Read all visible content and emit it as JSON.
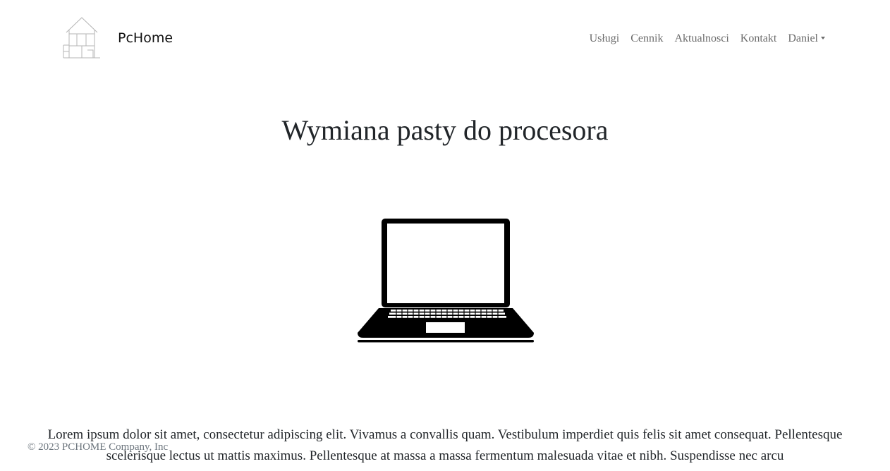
{
  "brand": {
    "name": "PcHome",
    "logo_icon": "house-outline-icon"
  },
  "nav": {
    "items": [
      {
        "label": "Usługi"
      },
      {
        "label": "Cennik"
      },
      {
        "label": "Aktualnosci"
      },
      {
        "label": "Kontakt"
      }
    ],
    "user_menu": {
      "label": "Daniel",
      "icon": "caret-down-icon"
    }
  },
  "main": {
    "title": "Wymiana pasty do procesora",
    "image_icon": "laptop-icon",
    "body": "Lorem ipsum dolor sit amet, consectetur adipiscing elit. Vivamus a convallis quam. Vestibulum imperdiet quis felis sit amet consequat. Pellentesque scelerisque lectus ut mattis maximus. Pellentesque at massa a massa fermentum malesuada vitae et nibh. Suspendisse nec arcu"
  },
  "footer": {
    "copyright": "© 2023 PCHOME Company, Inc"
  },
  "colors": {
    "nav_link": "#6c6c6c",
    "text": "#212529",
    "footer_text": "#6c757d",
    "background": "#ffffff"
  }
}
